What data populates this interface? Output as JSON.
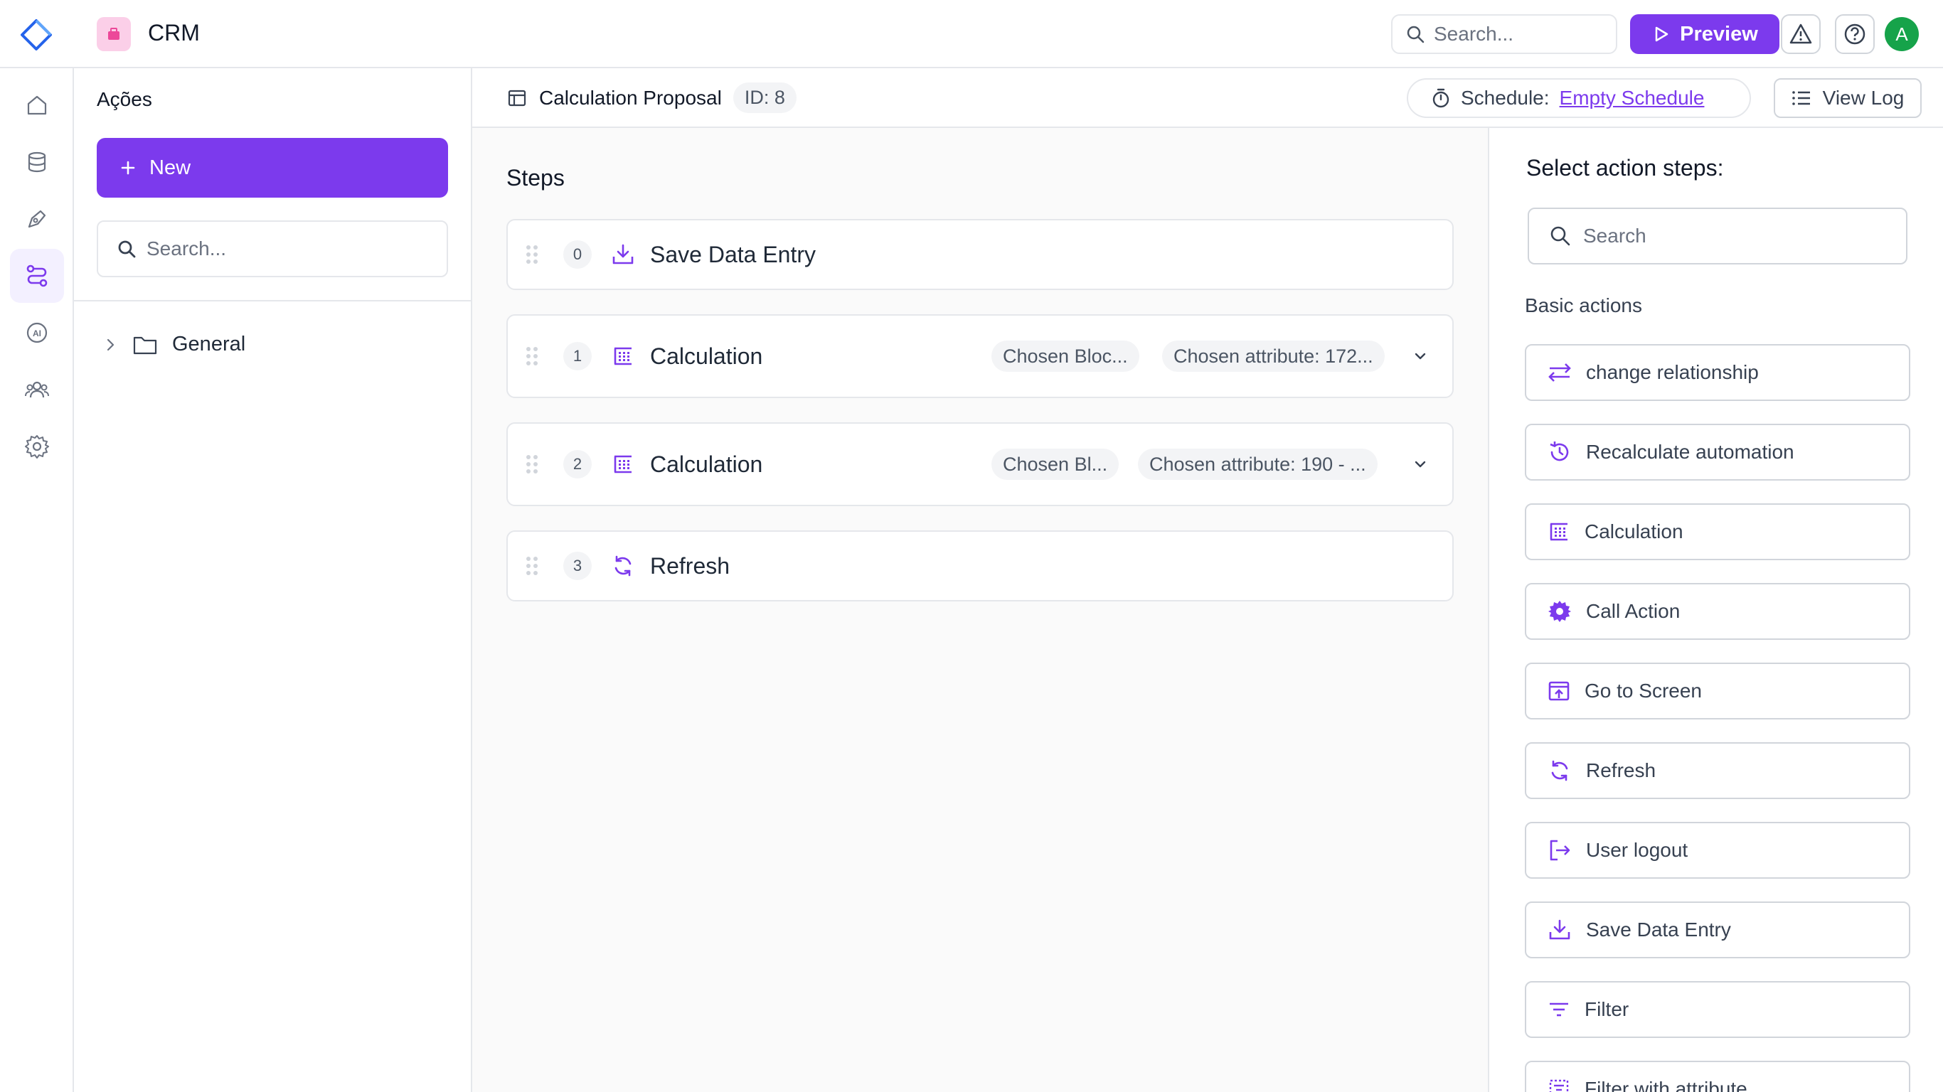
{
  "app": {
    "title": "CRM",
    "search_placeholder": "Search...",
    "preview_label": "Preview",
    "avatar_initial": "A",
    "accent_color": "#7c3aed"
  },
  "rail": {
    "items": [
      "home-icon",
      "database-icon",
      "pen-tool-icon",
      "workflow-icon",
      "ai-icon",
      "users-icon",
      "settings-icon"
    ],
    "active": "workflow-icon"
  },
  "left_panel": {
    "title": "Ações",
    "new_label": "New",
    "search_placeholder": "Search...",
    "folders": [
      {
        "label": "General"
      }
    ]
  },
  "header": {
    "title": "Calculation Proposal",
    "id_label": "ID: 8",
    "schedule_label": "Schedule:",
    "schedule_value": "Empty Schedule",
    "view_log_label": "View Log"
  },
  "steps": {
    "title": "Steps",
    "items": [
      {
        "index": "0",
        "label": "Save Data Entry",
        "icon": "save-download-icon",
        "chips": []
      },
      {
        "index": "1",
        "label": "Calculation",
        "icon": "calculation-icon",
        "chips": [
          "Chosen Bloc...",
          "Chosen attribute: 172..."
        ]
      },
      {
        "index": "2",
        "label": "Calculation",
        "icon": "calculation-icon",
        "chips": [
          "Chosen Bl...",
          "Chosen attribute: 190 - ..."
        ]
      },
      {
        "index": "3",
        "label": "Refresh",
        "icon": "refresh-icon",
        "chips": []
      }
    ]
  },
  "actions_panel": {
    "title": "Select action steps:",
    "search_placeholder": "Search",
    "section_label": "Basic actions",
    "items": [
      {
        "label": "change relationship",
        "icon": "relationship-icon"
      },
      {
        "label": "Recalculate automation",
        "icon": "recalculate-icon"
      },
      {
        "label": "Calculation",
        "icon": "calculation-icon"
      },
      {
        "label": "Call Action",
        "icon": "gear-icon"
      },
      {
        "label": "Go to Screen",
        "icon": "screen-icon"
      },
      {
        "label": "Refresh",
        "icon": "refresh-icon"
      },
      {
        "label": "User logout",
        "icon": "logout-icon"
      },
      {
        "label": "Save Data Entry",
        "icon": "save-download-icon"
      },
      {
        "label": "Filter",
        "icon": "filter-icon"
      },
      {
        "label": "Filter with attribute",
        "icon": "filter-attribute-icon"
      }
    ]
  }
}
